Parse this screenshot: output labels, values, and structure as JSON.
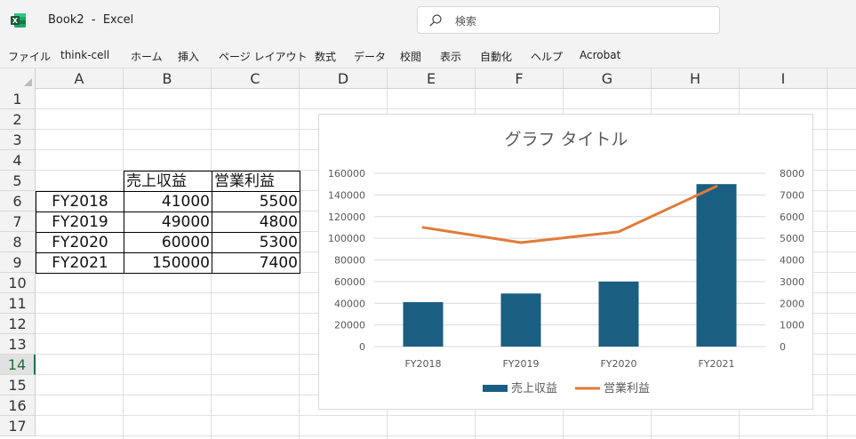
{
  "window": {
    "doc_title": "Book2  -  Excel",
    "search_placeholder": "検索"
  },
  "menu": [
    "ファイル",
    "think-cell",
    "ホーム",
    "挿入",
    "ページ レイアウト",
    "数式",
    "データ",
    "校閲",
    "表示",
    "自動化",
    "ヘルプ",
    "Acrobat"
  ],
  "columns": [
    "A",
    "B",
    "C",
    "D",
    "E",
    "F",
    "G",
    "H",
    "I"
  ],
  "rows": [
    "1",
    "2",
    "3",
    "4",
    "5",
    "6",
    "7",
    "8",
    "9",
    "10",
    "11",
    "12",
    "13",
    "14",
    "15",
    "16",
    "17"
  ],
  "active_row": "14",
  "table": {
    "headers": [
      "売上収益",
      "営業利益"
    ],
    "rows": [
      {
        "label": "FY2018",
        "revenue": "41000",
        "profit": "5500"
      },
      {
        "label": "FY2019",
        "revenue": "49000",
        "profit": "4800"
      },
      {
        "label": "FY2020",
        "revenue": "60000",
        "profit": "5300"
      },
      {
        "label": "FY2021",
        "revenue": "150000",
        "profit": "7400"
      }
    ]
  },
  "colors": {
    "bar": "#1a5e82",
    "line": "#e07b39",
    "excel_green": "#1e7145"
  },
  "chart_data": {
    "type": "bar",
    "title": "グラフ タイトル",
    "categories": [
      "FY2018",
      "FY2019",
      "FY2020",
      "FY2021"
    ],
    "series": [
      {
        "name": "売上収益",
        "type": "bar",
        "axis": "left",
        "values": [
          41000,
          49000,
          60000,
          150000
        ]
      },
      {
        "name": "営業利益",
        "type": "line",
        "axis": "right",
        "values": [
          5500,
          4800,
          5300,
          7400
        ]
      }
    ],
    "y_left": {
      "min": 0,
      "max": 160000,
      "ticks": [
        "0",
        "20000",
        "40000",
        "60000",
        "80000",
        "100000",
        "120000",
        "140000",
        "160000"
      ]
    },
    "y_right": {
      "min": 0,
      "max": 8000,
      "ticks": [
        "0",
        "1000",
        "2000",
        "3000",
        "4000",
        "5000",
        "6000",
        "7000",
        "8000"
      ]
    },
    "grid": true,
    "legend": "bottom"
  }
}
